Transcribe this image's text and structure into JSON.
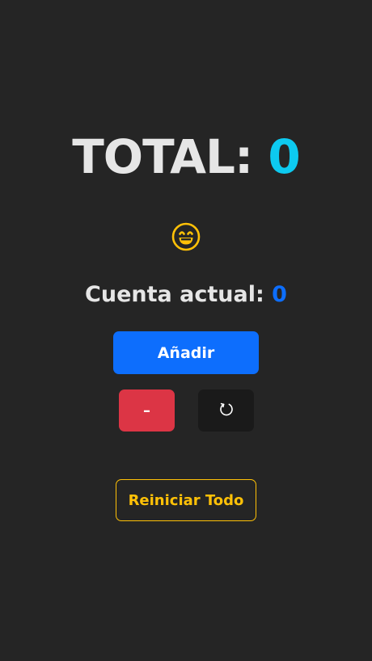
{
  "total": {
    "label": "TOTAL:",
    "value": "0"
  },
  "mood": {
    "icon": "grinning-face-icon"
  },
  "current": {
    "label": "Cuenta actual:",
    "value": "0"
  },
  "buttons": {
    "add_label": "Añadir",
    "minus_label": "–",
    "reset_icon": "refresh-icon",
    "reset_all_label": "Reiniciar Todo"
  },
  "colors": {
    "background": "#252525",
    "total_value": "#0dcaf0",
    "count_value": "#0d6efd",
    "primary": "#0d6efd",
    "danger": "#dc3545",
    "warning": "#ffc107",
    "dark": "#1a1a1a"
  }
}
